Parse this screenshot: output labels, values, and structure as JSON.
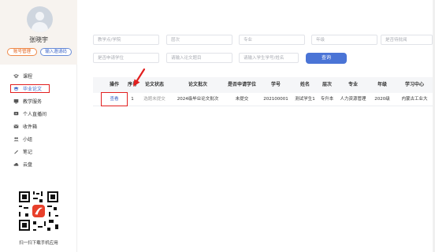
{
  "user": {
    "name": "张晓宇",
    "account_button": "账号管理",
    "invite_button": "输入邀请码"
  },
  "sidebar": {
    "items": [
      {
        "label": "课程",
        "icon": "course-icon"
      },
      {
        "label": "毕业论文",
        "icon": "graduation-cap-icon",
        "active": true
      },
      {
        "label": "教学服务",
        "icon": "teaching-icon"
      },
      {
        "label": "个人直播间",
        "icon": "live-room-icon"
      },
      {
        "label": "收件箱",
        "icon": "inbox-icon"
      },
      {
        "label": "小组",
        "icon": "group-icon"
      },
      {
        "label": "笔记",
        "icon": "note-icon"
      },
      {
        "label": "云盘",
        "icon": "cloud-icon"
      }
    ],
    "qr_caption": "扫一扫下载手机应用"
  },
  "filters": {
    "row1": [
      {
        "placeholder": "教学点/学院"
      },
      {
        "placeholder": "层次"
      },
      {
        "placeholder": "专业"
      },
      {
        "placeholder": "年级"
      },
      {
        "placeholder": "是否待批阅"
      }
    ],
    "row2": [
      {
        "placeholder": "是否申请学位"
      },
      {
        "placeholder": "请输入论文题目"
      },
      {
        "placeholder": "请输入学生学号/姓名"
      }
    ],
    "search_label": "查询"
  },
  "table": {
    "headers": [
      "操作",
      "序号",
      "论文状态",
      "论文批次",
      "是否申请学位",
      "学号",
      "姓名",
      "层次",
      "专业",
      "年级",
      "学习中心"
    ],
    "rows": [
      {
        "action": "查看",
        "index": "1",
        "status": "选题未提交",
        "batch": "2024级毕业论文批次",
        "degree": "未提交",
        "student_id": "202100001",
        "name": "测试学生1",
        "level": "专升本",
        "major": "人力资源管理",
        "grade": "2020级",
        "center": "内蒙古工业大"
      }
    ]
  },
  "colors": {
    "accent": "#4a74d6",
    "highlight": "#e21f1f",
    "pill_orange": "#e2621b"
  }
}
